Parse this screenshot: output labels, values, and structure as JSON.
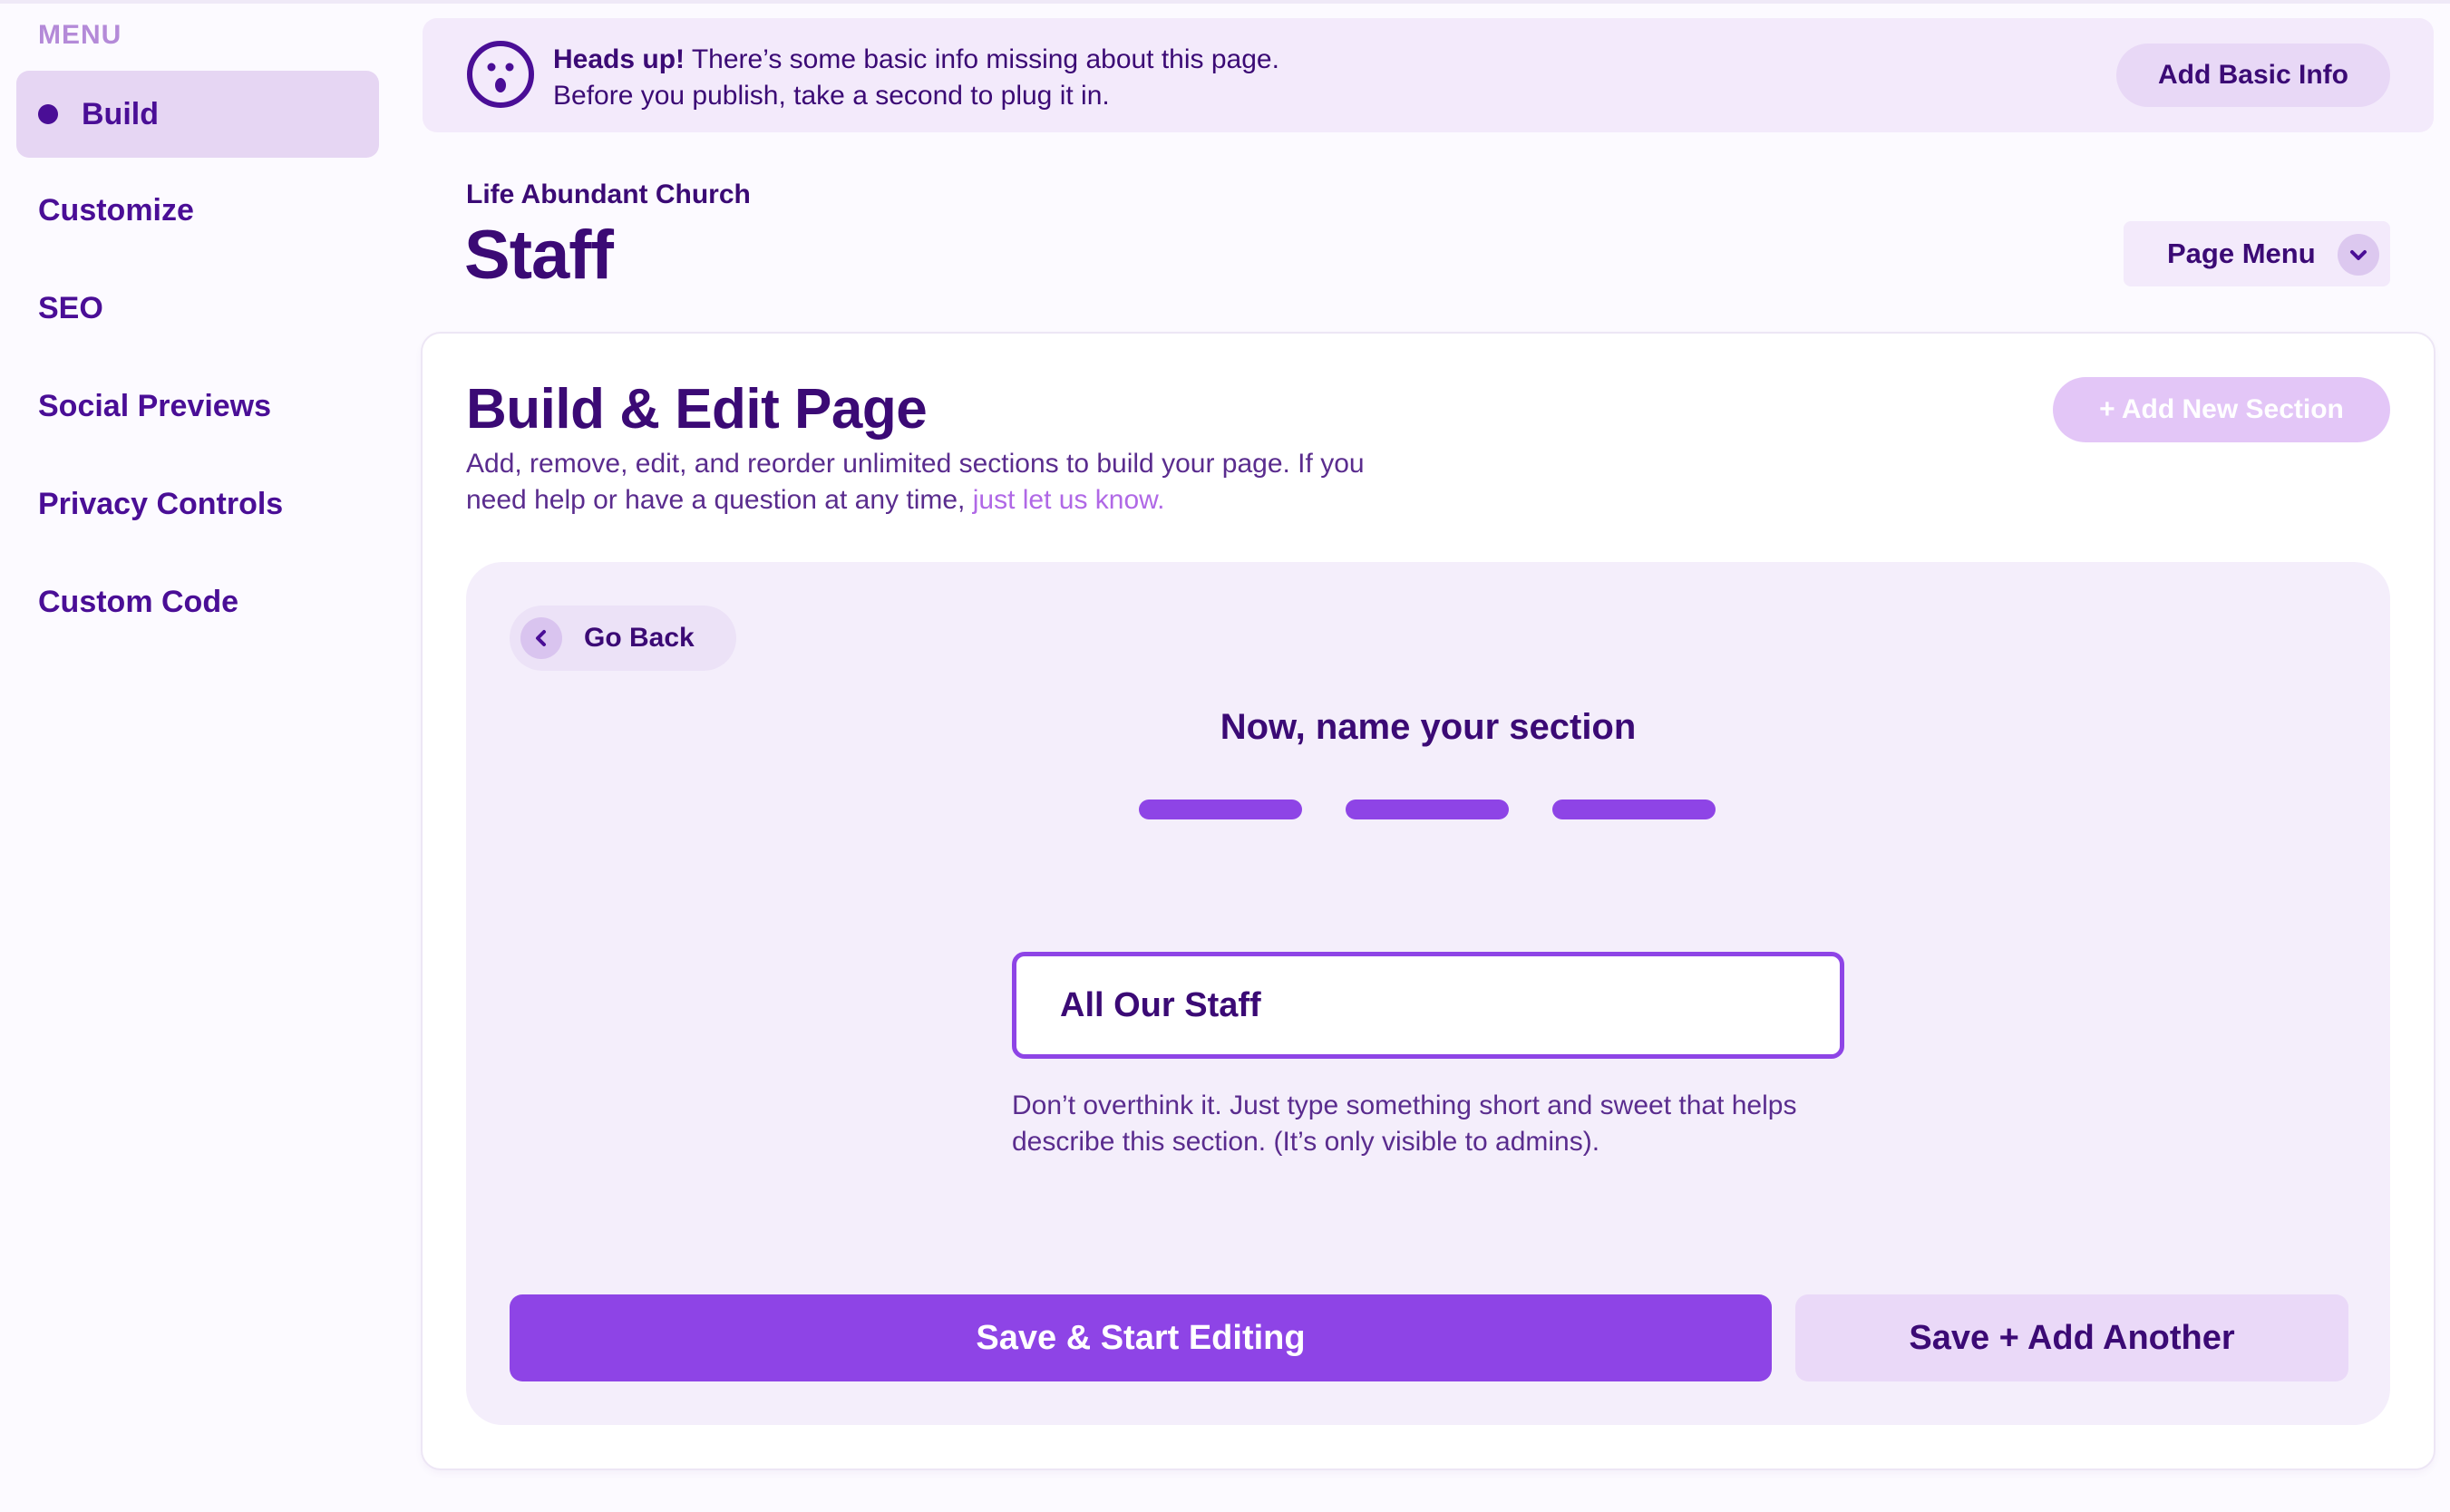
{
  "sidebar": {
    "menu_label": "MENU",
    "items": [
      {
        "label": "Build",
        "active": true
      },
      {
        "label": "Customize"
      },
      {
        "label": "SEO"
      },
      {
        "label": "Social Previews"
      },
      {
        "label": "Privacy Controls"
      },
      {
        "label": "Custom Code"
      }
    ]
  },
  "banner": {
    "icon": "surprised-face-icon",
    "heading": "Heads up!",
    "line1": " There’s some basic info missing about this page.",
    "line2": "Before you publish, take a second to plug it in.",
    "button_label": "Add Basic Info"
  },
  "header": {
    "org_name": "Life Abundant Church",
    "page_title": "Staff",
    "page_menu_label": "Page Menu",
    "page_menu_icon": "chevron-down-icon"
  },
  "card": {
    "title": "Build & Edit Page",
    "description": "Add, remove, edit, and reorder unlimited sections to build your page. If you need help or have a question at any time, ",
    "help_link": "just let us know.",
    "add_section_label": "+ Add New Section"
  },
  "panel": {
    "go_back_label": "Go Back",
    "go_back_icon": "chevron-left-icon",
    "step_title": "Now, name your section",
    "steps_total": 3,
    "steps_completed": 3,
    "section_name_value": "All Our Staff",
    "hint": "Don’t overthink it. Just type something short and sweet that helps describe this section. (It’s only visible to admins).",
    "primary_button": "Save & Start Editing",
    "secondary_button": "Save + Add Another"
  },
  "colors": {
    "accent": "#8e44e6",
    "text": "#3b0a75",
    "sidebar_active_bg": "#e6d6f3",
    "link": "#b068e6"
  }
}
